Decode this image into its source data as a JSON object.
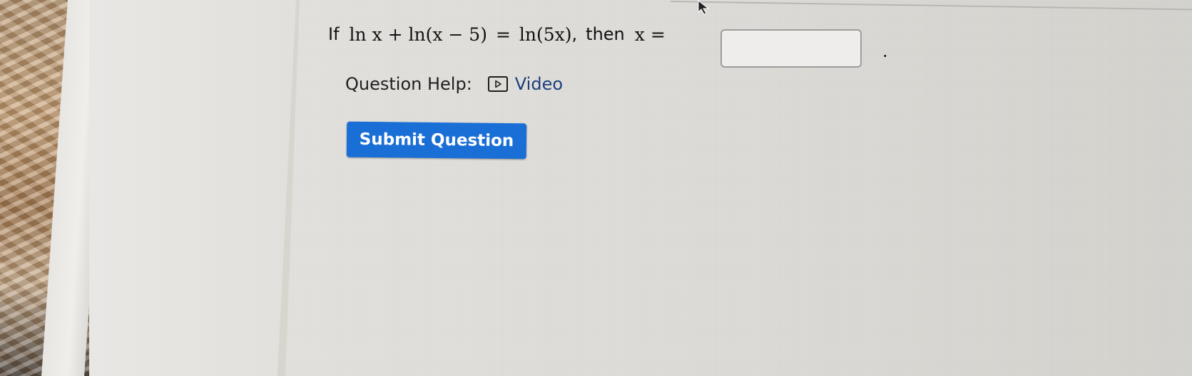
{
  "question": {
    "prefix": "If",
    "equation_lhs": "ln x + ln(x − 5)",
    "equals": "=",
    "equation_rhs": "ln(5x)",
    "comma": ",",
    "then_label": "then",
    "answer_var": "x =",
    "answer_value": "",
    "period": "."
  },
  "help": {
    "label": "Question Help:",
    "video_label": "Video",
    "video_icon": "play-icon"
  },
  "actions": {
    "submit_label": "Submit Question"
  },
  "colors": {
    "button": "#1a6fd6",
    "link": "#1d3f7c"
  }
}
